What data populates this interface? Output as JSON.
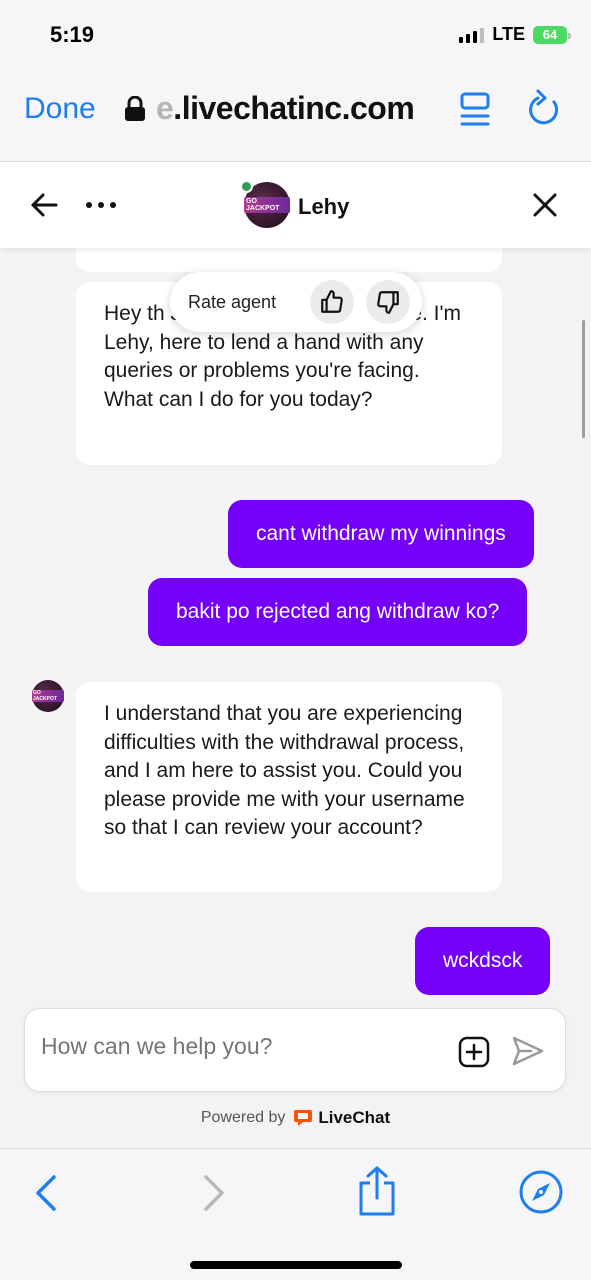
{
  "status_bar": {
    "time": "5:19",
    "network": "LTE",
    "battery": "64"
  },
  "browser": {
    "done_label": "Done",
    "url_prefix": "e",
    "url_main": ".livechatinc.com",
    "icons": [
      "lock-icon",
      "reader-icon",
      "reload-icon"
    ]
  },
  "chat_header": {
    "agent_name": "Lehy",
    "avatar_text": "GO JACKPOT",
    "icons": [
      "back-arrow-icon",
      "more-icon",
      "close-icon"
    ]
  },
  "rate_popup": {
    "label": "Rate agent",
    "icons": [
      "thumbs-up-icon",
      "thumbs-down-icon"
    ]
  },
  "messages": [
    {
      "from": "agent",
      "text": "Hey th Jackpot's customer service. I'm Lehy, here to lend a hand with any queries or problems you're facing. What can I do for you today?"
    },
    {
      "from": "user",
      "text": "cant withdraw my winnings"
    },
    {
      "from": "user",
      "text": "bakit po rejected ang withdraw ko?"
    },
    {
      "from": "agent",
      "text": "I understand that you are experiencing difficulties with the withdrawal process, and I am here to assist you. Could you please provide me with your username so that I can review your account?"
    },
    {
      "from": "user",
      "text": "wckdsck"
    }
  ],
  "composer": {
    "placeholder": "How can we help you?",
    "icons": [
      "add-icon",
      "send-icon"
    ]
  },
  "footer": {
    "powered_by": "Powered by",
    "brand": "LiveChat"
  },
  "bottom_bar": {
    "icons": [
      "back-icon",
      "forward-icon",
      "share-icon",
      "compass-icon"
    ]
  },
  "colors": {
    "accent": "#1d7ef0",
    "user_bubble": "#7400f7",
    "online": "#2e9d5c",
    "livechat": "#ff5100"
  }
}
